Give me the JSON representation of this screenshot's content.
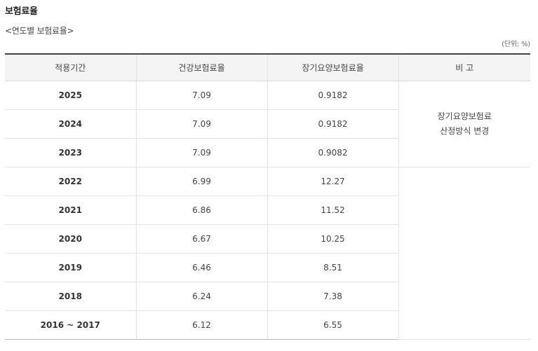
{
  "page": {
    "title": "보험료율",
    "caption": "<연도별 보험료율>",
    "unit": "(단위: %)"
  },
  "table": {
    "headers": [
      "적용기간",
      "건강보험료율",
      "장기요양보험료율",
      "비 고"
    ],
    "rows": [
      {
        "period": "2025",
        "health": "7.09",
        "ltc": "0.9182"
      },
      {
        "period": "2024",
        "health": "7.09",
        "ltc": "0.9182"
      },
      {
        "period": "2023",
        "health": "7.09",
        "ltc": "0.9082"
      },
      {
        "period": "2022",
        "health": "6.99",
        "ltc": "12.27"
      },
      {
        "period": "2021",
        "health": "6.86",
        "ltc": "11.52"
      },
      {
        "period": "2020",
        "health": "6.67",
        "ltc": "10.25"
      },
      {
        "period": "2019",
        "health": "6.46",
        "ltc": "8.51"
      },
      {
        "period": "2018",
        "health": "6.24",
        "ltc": "7.38"
      },
      {
        "period": "2016 ~ 2017",
        "health": "6.12",
        "ltc": "6.55"
      }
    ],
    "note": {
      "line1": "장기요양보험료",
      "line2": "산정방식 변경"
    }
  }
}
